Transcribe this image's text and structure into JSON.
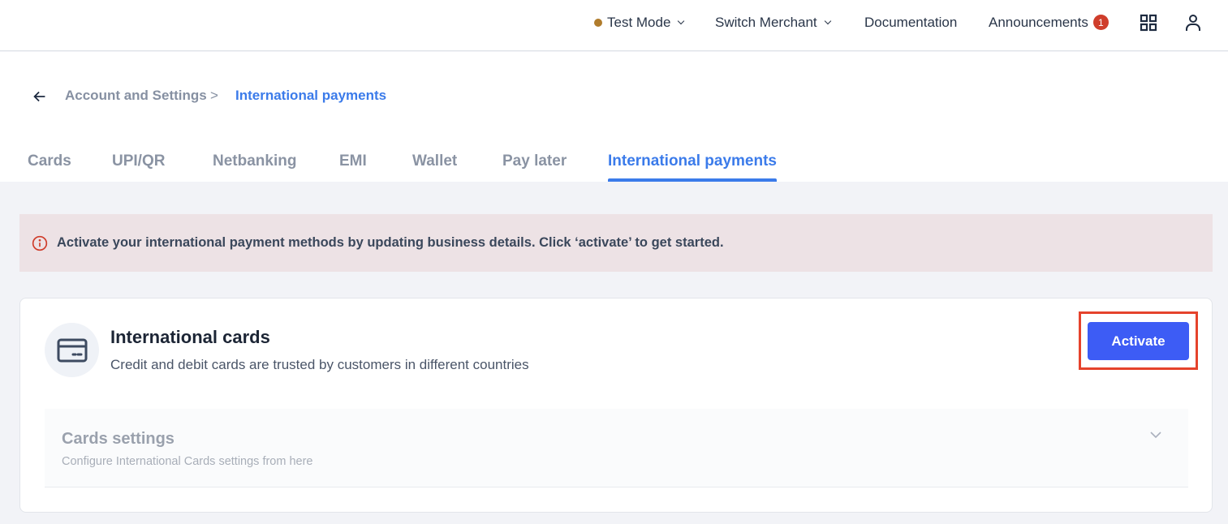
{
  "topbar": {
    "mode_label": "Test Mode",
    "mode_dot_color": "#b07c2c",
    "switch_merchant_label": "Switch Merchant",
    "documentation_label": "Documentation",
    "announcements_label": "Announcements",
    "announcements_count": "1",
    "apps_icon": "grid-icon",
    "profile_icon": "user-icon"
  },
  "breadcrumb": {
    "back_icon": "arrow-left-icon",
    "parent": "Account and Settings",
    "separator": ">",
    "current": "International payments"
  },
  "tabs": [
    {
      "label": "Cards",
      "active": false
    },
    {
      "label": "UPI/QR",
      "active": false
    },
    {
      "label": "Netbanking",
      "active": false
    },
    {
      "label": "EMI",
      "active": false
    },
    {
      "label": "Wallet",
      "active": false
    },
    {
      "label": "Pay later",
      "active": false
    },
    {
      "label": "International payments",
      "active": true
    }
  ],
  "alert": {
    "icon": "info-icon",
    "text": "Activate your international payment methods by updating business details. Click ‘activate’ to get started."
  },
  "card": {
    "icon": "credit-card-icon",
    "title": "International cards",
    "description": "Credit and debit cards are trusted by customers in different countries",
    "activate_label": "Activate",
    "settings": {
      "title": "Cards settings",
      "description": "Configure International Cards settings from here"
    }
  },
  "colors": {
    "accent": "#3b7bea",
    "button": "#3d5cf5",
    "highlight_outline": "#e5432c",
    "badge": "#cf3d2b",
    "alert_bg": "#ede2e5"
  }
}
